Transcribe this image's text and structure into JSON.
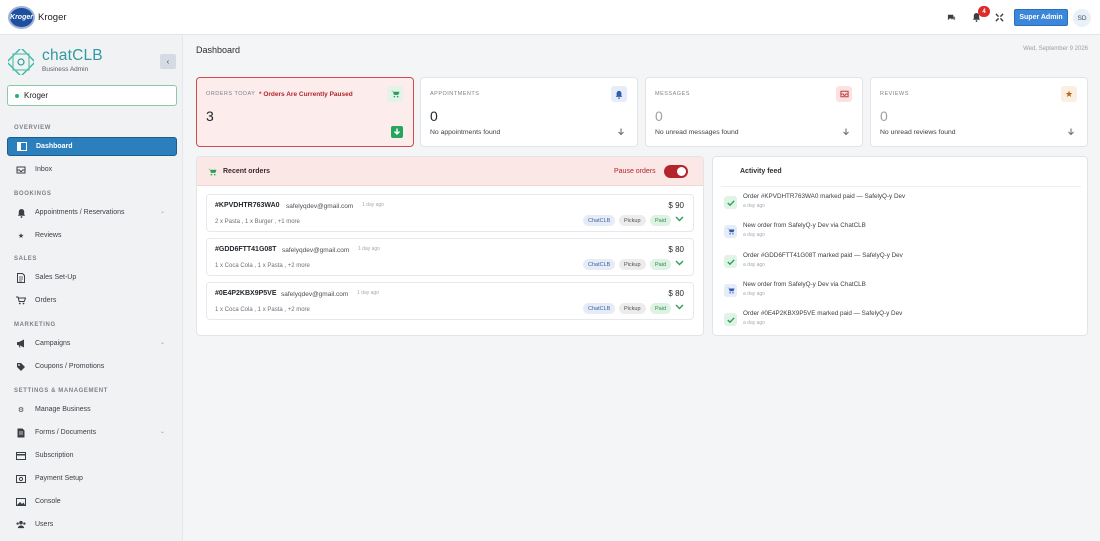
{
  "topbar": {
    "brand_logo_text": "Kroger",
    "brand_name": "Kroger",
    "notif_count": "4",
    "admin_label": "Super Admin",
    "avatar_initials": "SD"
  },
  "sidebar": {
    "logo_name": "chatCLB",
    "logo_sub": "Business Admin",
    "business": "Kroger",
    "sections": {
      "overview": "OVERVIEW",
      "bookings": "BOOKINGS",
      "sales": "SALES",
      "marketing": "MARKETING",
      "settings": "SETTINGS & MANAGEMENT"
    },
    "items": {
      "dashboard": "Dashboard",
      "inbox": "Inbox",
      "appointments": "Appointments / Reservations",
      "reviews": "Reviews",
      "sales_setup": "Sales Set-Up",
      "orders": "Orders",
      "campaigns": "Campaigns",
      "coupons": "Coupons / Promotions",
      "manage_business": "Manage Business",
      "forms": "Forms / Documents",
      "subscription": "Subscription",
      "payment_setup": "Payment Setup",
      "console": "Console",
      "users": "Users"
    }
  },
  "main": {
    "title": "Dashboard",
    "date": "Wed, September 9 2026"
  },
  "stats": {
    "orders": {
      "label": "ORDERS TODAY",
      "warning": "Orders Are Currently Paused",
      "value": "3"
    },
    "appointments": {
      "label": "APPOINTMENTS",
      "value": "0",
      "sub": "No appointments found"
    },
    "messages": {
      "label": "MESSAGES",
      "value": "0",
      "sub": "No unread messages found"
    },
    "reviews": {
      "label": "REVIEWS",
      "value": "0",
      "sub": "No unread reviews found"
    }
  },
  "recent_orders": {
    "title": "Recent orders",
    "pause_label": "Pause orders",
    "orders": [
      {
        "id": "#KPVDHTR763WA0",
        "email": "safelyqdev@gmail.com",
        "ago": "1 day ago",
        "items": "2 x Pasta , 1 x Burger , +1 more",
        "price": "$ 90",
        "tags": [
          "ChatCLB",
          "Pickup",
          "Paid"
        ]
      },
      {
        "id": "#GDD6FTT41G08T",
        "email": "safelyqdev@gmail.com",
        "ago": "1 day ago",
        "items": "1 x Coca Cola , 1 x Pasta , +2 more",
        "price": "$ 80",
        "tags": [
          "ChatCLB",
          "Pickup",
          "Paid"
        ]
      },
      {
        "id": "#0E4P2KBX9P5VE",
        "email": "safelyqdev@gmail.com",
        "ago": "1 day ago",
        "items": "1 x Coca Cola , 1 x Pasta , +2 more",
        "price": "$ 80",
        "tags": [
          "ChatCLB",
          "Pickup",
          "Paid"
        ]
      }
    ]
  },
  "activity": {
    "title": "Activity feed",
    "items": [
      {
        "text": "Order #KPVDHTR763WA0 marked paid — SafelyQ-y Dev",
        "ago": "a day ago",
        "icon": "check-icon"
      },
      {
        "text": "New order from SafelyQ-y Dev via ChatCLB",
        "ago": "a day ago",
        "icon": "cart-icon"
      },
      {
        "text": "Order #GDD6FTT41G08T marked paid — SafelyQ-y Dev",
        "ago": "a day ago",
        "icon": "check-icon"
      },
      {
        "text": "New order from SafelyQ-y Dev via ChatCLB",
        "ago": "a day ago",
        "icon": "cart-icon"
      },
      {
        "text": "Order #0E4P2KBX9P5VE marked paid — SafelyQ-y Dev",
        "ago": "a day ago",
        "icon": "check-icon"
      }
    ]
  },
  "colors": {
    "accent": "#2c7fbd",
    "danger": "#b3252b",
    "success": "#27a15a"
  }
}
